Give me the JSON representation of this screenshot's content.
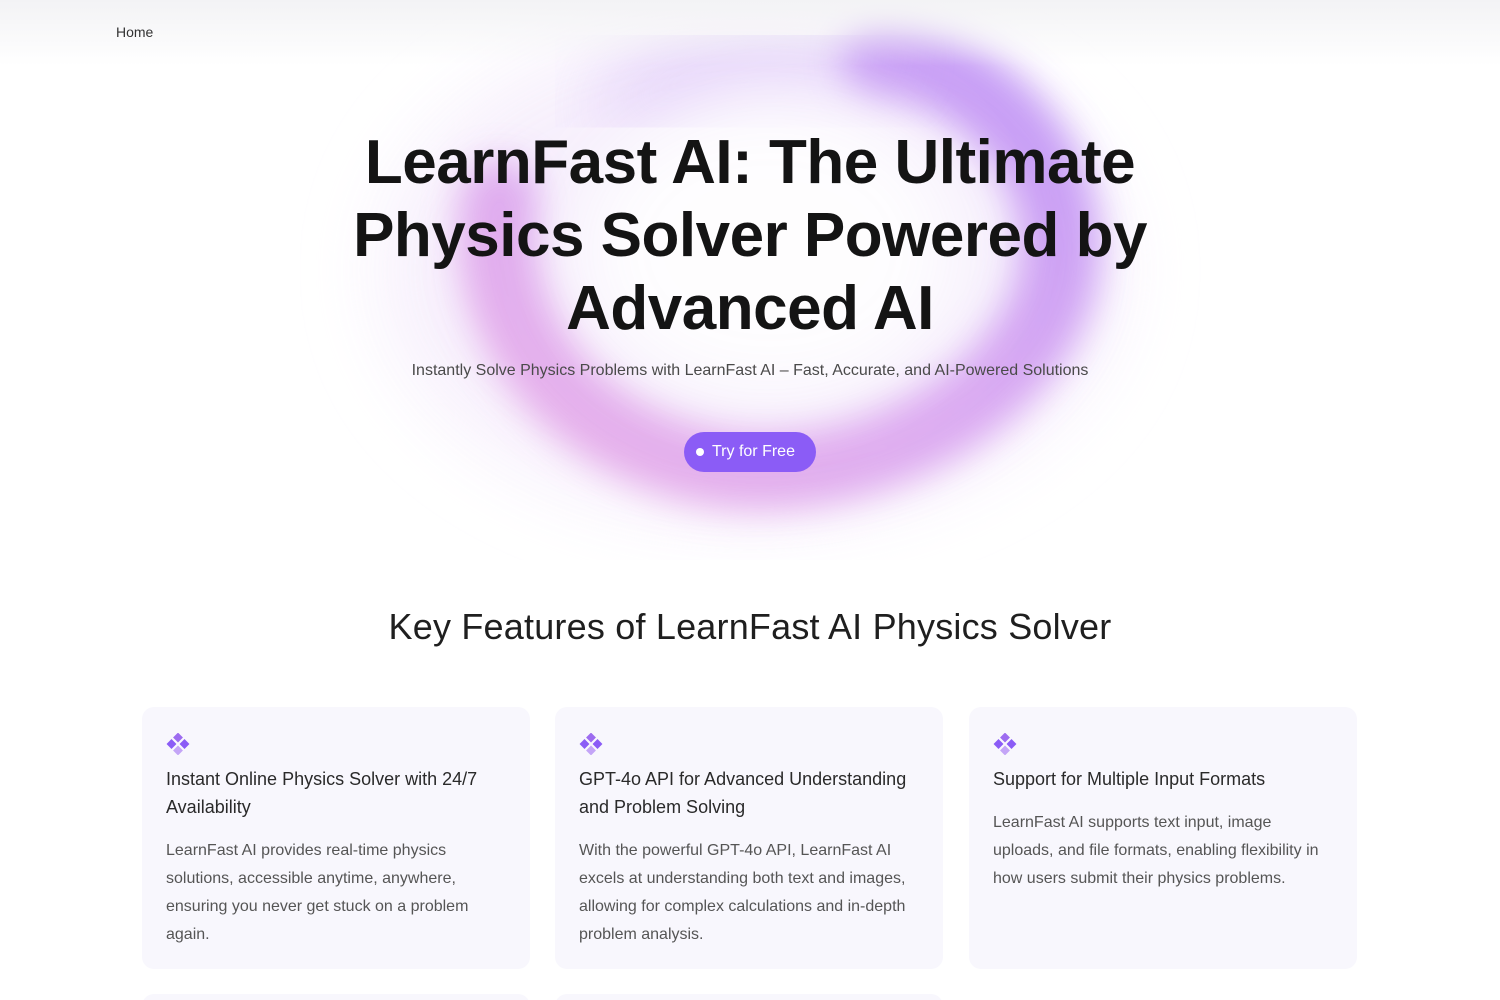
{
  "nav": {
    "home_label": "Home"
  },
  "hero": {
    "title": "LearnFast AI: The Ultimate Physics Solver Powered by Advanced AI",
    "subtitle": "Instantly Solve Physics Problems with LearnFast AI – Fast, Accurate, and AI-Powered Solutions",
    "cta_label": "Try for Free"
  },
  "features": {
    "heading": "Key Features of LearnFast AI Physics Solver",
    "cards": [
      {
        "icon": "diamond-cluster-icon",
        "title": "Instant Online Physics Solver with 24/7 Availability",
        "text": "LearnFast AI provides real-time physics solutions, accessible anytime, anywhere, ensuring you never get stuck on a problem again."
      },
      {
        "icon": "diamond-cluster-icon",
        "title": "GPT-4o API for Advanced Understanding and Problem Solving",
        "text": "With the powerful GPT-4o API, LearnFast AI excels at understanding both text and images, allowing for complex calculations and in-depth problem analysis."
      },
      {
        "icon": "diamond-cluster-icon",
        "title": "Support for Multiple Input Formats",
        "text": "LearnFast AI supports text input, image uploads, and file formats, enabling flexibility in how users submit their physics problems."
      }
    ]
  },
  "colors": {
    "accent": "#8b5cf6",
    "card_background": "#f8f7fd",
    "glow_purple": "#b98cf5",
    "glow_pink": "#e7a6e6"
  }
}
